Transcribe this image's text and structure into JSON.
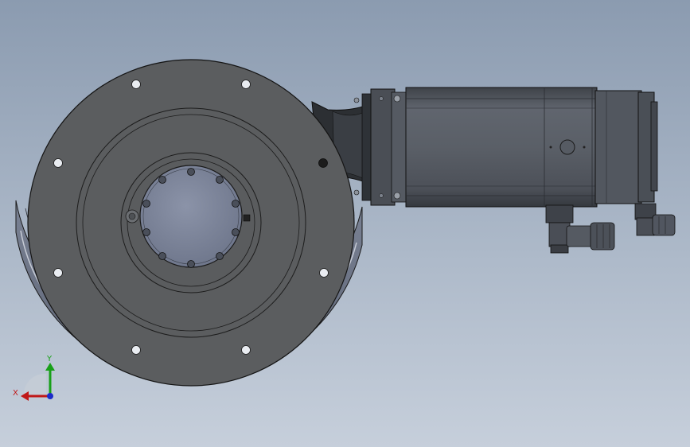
{
  "viewport": {
    "background_top": "#8b9bb0",
    "background_bottom": "#c6cfdb"
  },
  "triad": {
    "x_label": "X",
    "y_label": "Y",
    "x_color": "#c01818",
    "y_color": "#18a018",
    "z_color": "#1c2cc8"
  },
  "model": {
    "body_color": "#5c5e60",
    "motor_color": "#5a5f67",
    "edge_color": "#1a1a1a",
    "cover_color": "#9aa0ae",
    "shield_color": "#6e7585"
  }
}
